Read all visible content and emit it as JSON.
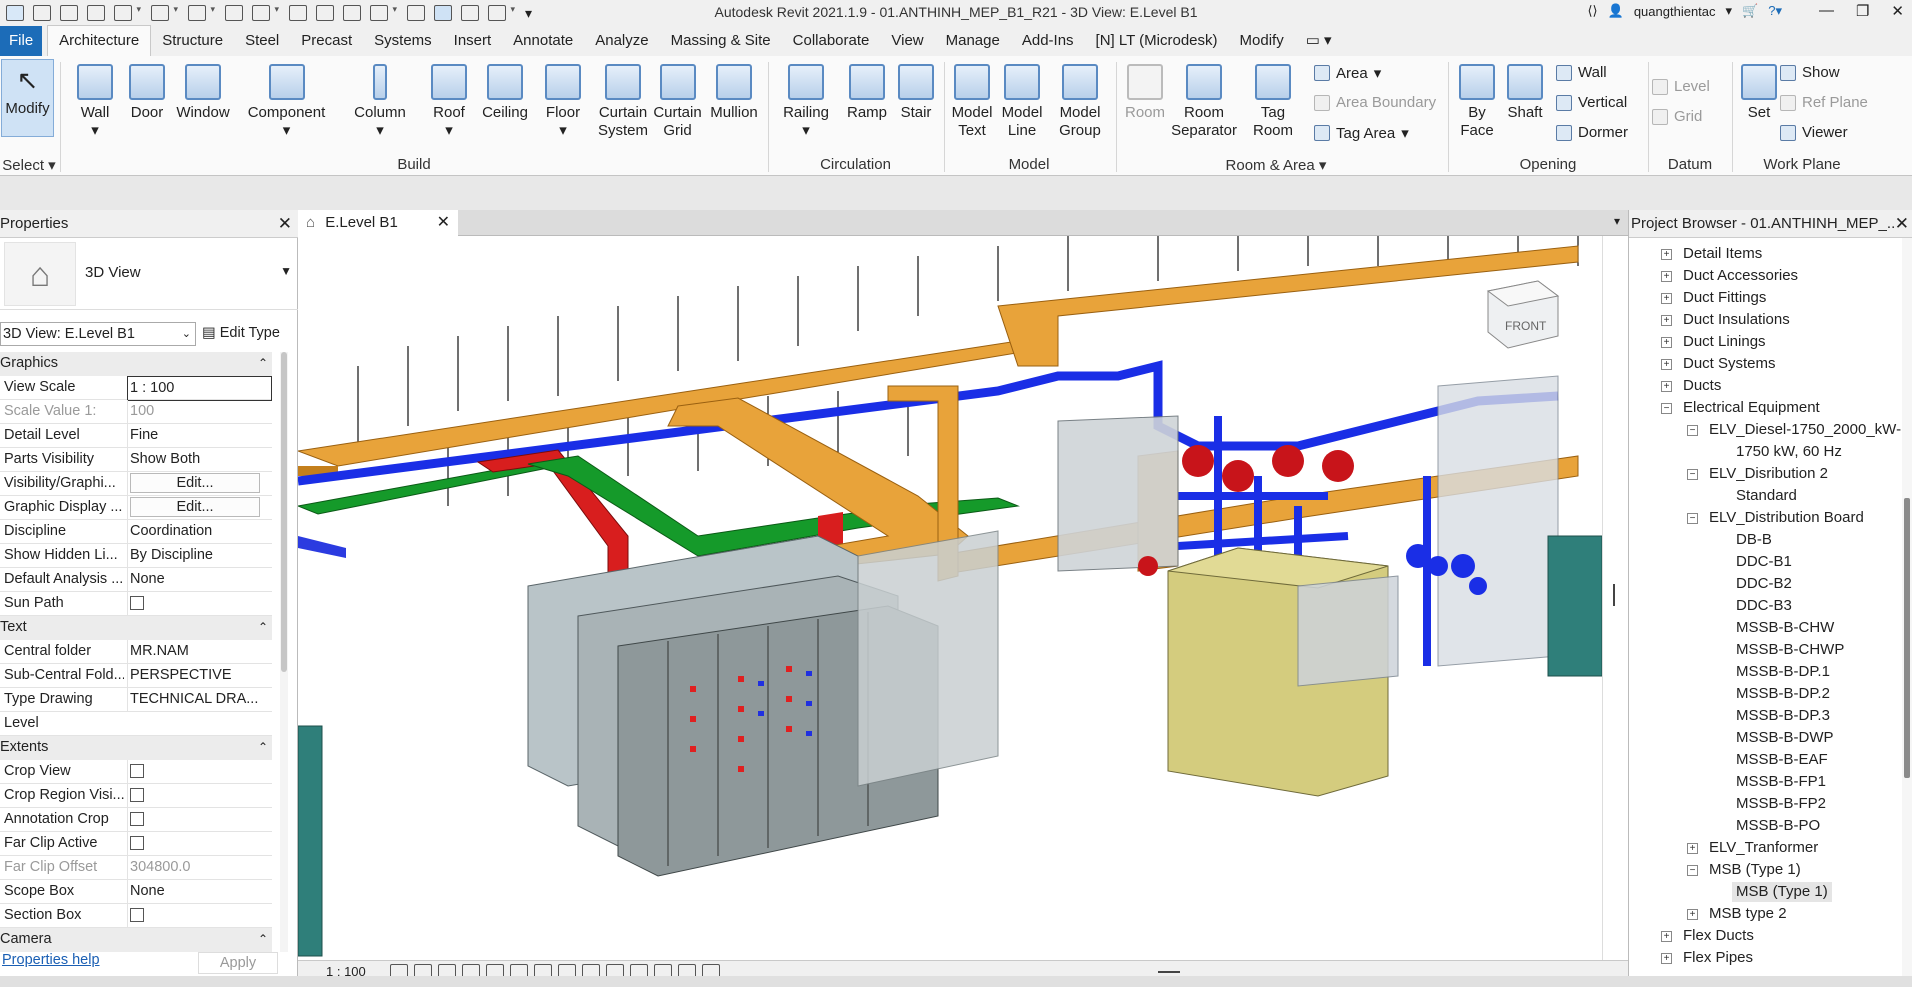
{
  "app": {
    "title": "Autodesk Revit 2021.1.9 - 01.ANTHINH_MEP_B1_R21 - 3D View: E.Level B1",
    "user": "quangthientac"
  },
  "tabs": [
    "File",
    "Architecture",
    "Structure",
    "Steel",
    "Precast",
    "Systems",
    "Insert",
    "Annotate",
    "Analyze",
    "Massing & Site",
    "Collaborate",
    "View",
    "Manage",
    "Add-Ins",
    "[N] LT (Microdesk)",
    "Modify"
  ],
  "ribbon": {
    "select": {
      "label": "Modify",
      "panel": "Select"
    },
    "build": {
      "panel": "Build",
      "buttons": [
        "Wall",
        "Door",
        "Window",
        "Component",
        "Column",
        "Roof",
        "Ceiling",
        "Floor",
        "Curtain System",
        "Curtain Grid",
        "Mullion"
      ]
    },
    "circulation": {
      "panel": "Circulation",
      "buttons": [
        "Railing",
        "Ramp",
        "Stair"
      ]
    },
    "model": {
      "panel": "Model",
      "buttons": [
        "Model Text",
        "Model Line",
        "Model Group"
      ]
    },
    "room": {
      "panel": "Room & Area",
      "buttons": [
        "Room",
        "Room Separator",
        "Tag Room"
      ],
      "small": [
        "Area",
        "Area  Boundary",
        "Tag  Area"
      ]
    },
    "opening": {
      "panel": "Opening",
      "buttons": [
        "By Face",
        "Shaft"
      ],
      "small": [
        "Wall",
        "Vertical",
        "Dormer"
      ]
    },
    "datum": {
      "panel": "Datum",
      "small": [
        "Level",
        "Grid"
      ]
    },
    "workplane": {
      "panel": "Work Plane",
      "buttons": [
        "Set"
      ],
      "small": [
        "Show",
        "Ref  Plane",
        "Viewer"
      ]
    }
  },
  "properties": {
    "title": "Properties",
    "type": "3D View",
    "selector": "3D View: E.Level B1",
    "edit_type": "Edit Type",
    "sections": {
      "graphics": "Graphics",
      "text": "Text",
      "extents": "Extents",
      "camera": "Camera"
    },
    "graphics_rows": [
      {
        "k": "View Scale",
        "v": "1 : 100"
      },
      {
        "k": "Scale Value    1:",
        "v": "100"
      },
      {
        "k": "Detail Level",
        "v": "Fine"
      },
      {
        "k": "Parts Visibility",
        "v": "Show Both"
      },
      {
        "k": "Visibility/Graphi...",
        "v": "Edit..."
      },
      {
        "k": "Graphic Display ...",
        "v": "Edit..."
      },
      {
        "k": "Discipline",
        "v": "Coordination"
      },
      {
        "k": "Show Hidden Li...",
        "v": "By Discipline"
      },
      {
        "k": "Default Analysis ...",
        "v": "None"
      },
      {
        "k": "Sun Path",
        "v": ""
      }
    ],
    "text_rows": [
      {
        "k": "Central folder",
        "v": "MR.NAM"
      },
      {
        "k": "Sub-Central Fold...",
        "v": "PERSPECTIVE"
      },
      {
        "k": "Type Drawing",
        "v": "TECHNICAL DRA..."
      },
      {
        "k": "Level",
        "v": ""
      }
    ],
    "extents_rows": [
      {
        "k": "Crop View",
        "v": ""
      },
      {
        "k": "Crop Region Visi...",
        "v": ""
      },
      {
        "k": "Annotation Crop",
        "v": ""
      },
      {
        "k": "Far Clip Active",
        "v": ""
      },
      {
        "k": "Far Clip Offset",
        "v": "304800.0"
      },
      {
        "k": "Scope Box",
        "v": "None"
      },
      {
        "k": "Section Box",
        "v": ""
      }
    ],
    "help": "Properties help",
    "apply": "Apply"
  },
  "view": {
    "tab": "E.Level B1",
    "scale": "1 : 100",
    "cube": "FRONT"
  },
  "browser": {
    "title": "Project Browser - 01.ANTHINH_MEP_...",
    "items": [
      "Detail Items",
      "Duct Accessories",
      "Duct Fittings",
      "Duct Insulations",
      "Duct Linings",
      "Duct Systems",
      "Ducts",
      "Electrical Equipment",
      "ELV_Diesel-1750_2000_kW-",
      "1750 kW, 60 Hz",
      "ELV_Disribution 2",
      "Standard",
      "ELV_Distribution Board",
      "DB-B",
      "DDC-B1",
      "DDC-B2",
      "DDC-B3",
      "MSSB-B-CHW",
      "MSSB-B-CHWP",
      "MSSB-B-DP.1",
      "MSSB-B-DP.2",
      "MSSB-B-DP.3",
      "MSSB-B-DWP",
      "MSSB-B-EAF",
      "MSSB-B-FP1",
      "MSSB-B-FP2",
      "MSSB-B-PO",
      "ELV_Tranformer",
      "MSB (Type 1)",
      "MSB (Type 1)",
      "MSB type 2",
      "Flex Ducts",
      "Flex Pipes"
    ]
  }
}
